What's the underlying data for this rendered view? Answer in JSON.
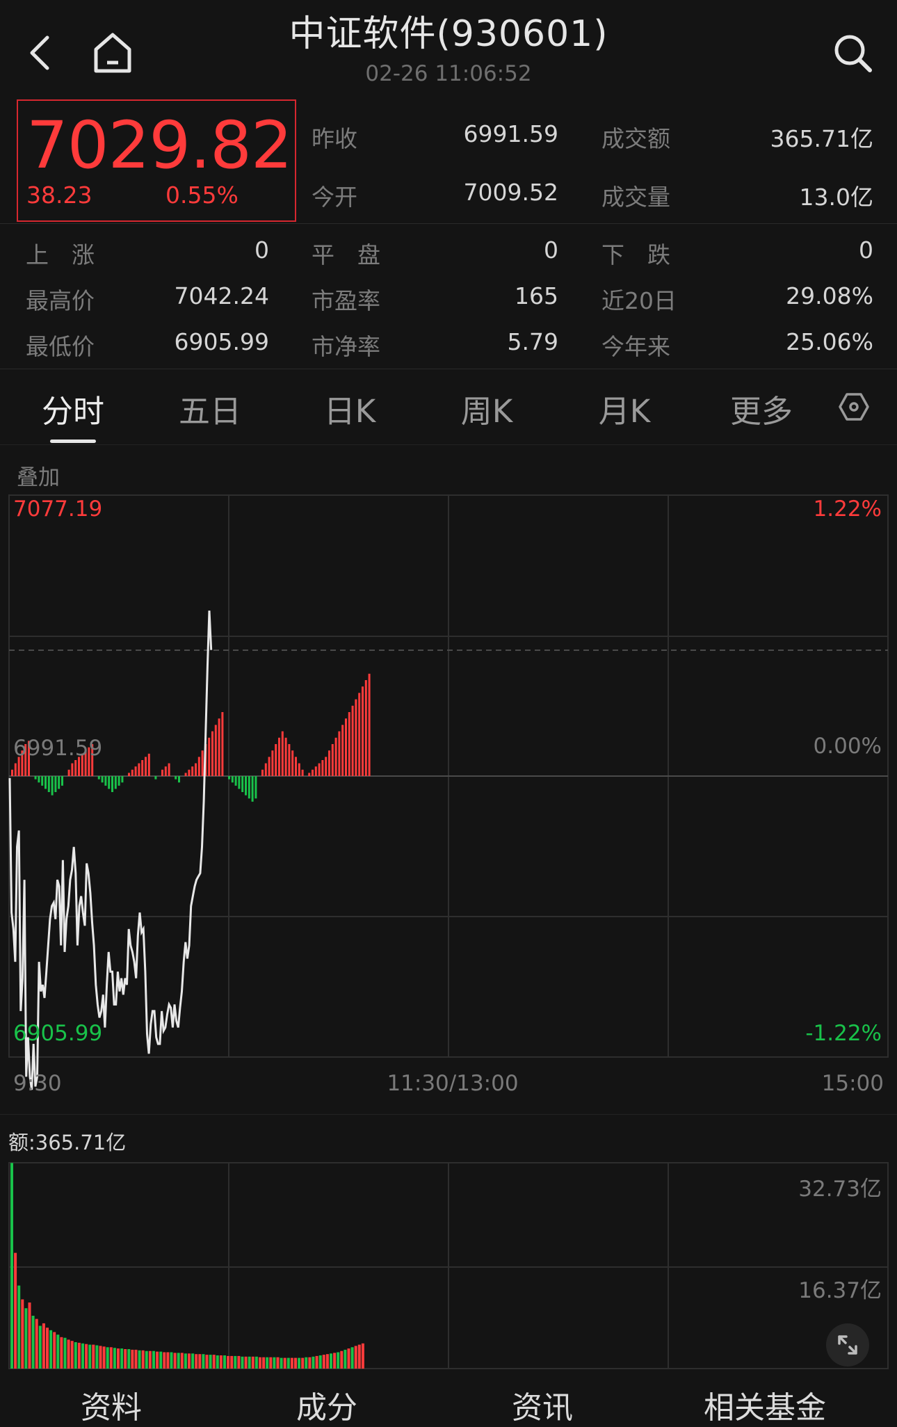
{
  "header": {
    "title": "中证软件(930601)",
    "datetime": "02-26 11:06:52",
    "back_icon": "chevron-left-icon",
    "home_icon": "home-icon",
    "search_icon": "search-icon"
  },
  "quote": {
    "price": "7029.82",
    "change": "38.23",
    "change_pct": "0.55%",
    "stats_top": [
      {
        "label": "昨收",
        "value": "6991.59"
      },
      {
        "label": "成交额",
        "value": "365.71亿"
      },
      {
        "label": "今开",
        "value": "7009.52"
      },
      {
        "label": "成交量",
        "value": "13.0亿"
      }
    ],
    "stats": [
      {
        "label": "上　涨",
        "value": "0"
      },
      {
        "label": "平　盘",
        "value": "0"
      },
      {
        "label": "下　跌",
        "value": "0"
      },
      {
        "label": "最高价",
        "value": "7042.24"
      },
      {
        "label": "市盈率",
        "value": "165"
      },
      {
        "label": "近20日",
        "value": "29.08%"
      },
      {
        "label": "最低价",
        "value": "6905.99"
      },
      {
        "label": "市净率",
        "value": "5.79"
      },
      {
        "label": "今年来",
        "value": "25.06%"
      }
    ]
  },
  "tabs": [
    {
      "label": "分时",
      "active": true
    },
    {
      "label": "五日"
    },
    {
      "label": "日K"
    },
    {
      "label": "周K"
    },
    {
      "label": "月K"
    },
    {
      "label": "更多"
    }
  ],
  "settings_icon": "hexagon-settings-icon",
  "overlay_label": "叠加",
  "colors": {
    "up": "#ff3b3b",
    "down": "#19c24a",
    "line": "#e8e8e8",
    "background": "#141414"
  },
  "chart_data": {
    "type": "line",
    "price_axis": {
      "max_label": "7077.19",
      "ref_label": "6991.59",
      "min_label": "6905.99",
      "ylim": [
        6905.99,
        7077.19
      ]
    },
    "pct_axis": {
      "max_label": "1.22%",
      "ref_label": "0.00%",
      "min_label": "-1.22%"
    },
    "x_labels": [
      "9:30",
      "11:30/13:00",
      "15:00"
    ],
    "series": [
      {
        "values": [
          6991,
          6950,
          6945,
          6935,
          6970,
          6975,
          6920,
          6930,
          6960,
          6900,
          6912,
          6900,
          6896,
          6910,
          6897,
          6900,
          6935,
          6926,
          6928,
          6924,
          6932,
          6940,
          6948,
          6952,
          6953,
          6948,
          6960,
          6958,
          6940,
          6966,
          6938,
          6948,
          6952,
          6960,
          6963,
          6970,
          6962,
          6940,
          6952,
          6955,
          6950,
          6946,
          6965,
          6962,
          6956,
          6947,
          6940,
          6928,
          6922,
          6918,
          6920,
          6925,
          6915,
          6928,
          6938,
          6932,
          6932,
          6922,
          6922,
          6932,
          6926,
          6930,
          6925,
          6930,
          6928,
          6945,
          6940,
          6938,
          6935,
          6930,
          6943,
          6950,
          6944,
          6945,
          6932,
          6913,
          6907,
          6916,
          6920,
          6920,
          6912,
          6910,
          6910,
          6920,
          6914,
          6915,
          6919,
          6922,
          6921,
          6915,
          6922,
          6917,
          6915,
          6921,
          6926,
          6935,
          6941,
          6936,
          6940,
          6952,
          6955,
          6958,
          6960,
          6961,
          6962,
          6970,
          6984,
          7005,
          7025,
          7042,
          7030
        ]
      }
    ],
    "direction_bars": [
      2,
      4,
      6,
      8,
      10,
      11,
      0,
      -1,
      -2,
      -3,
      -4,
      -5,
      -6,
      -5,
      -4,
      -3,
      0,
      2,
      4,
      5,
      6,
      7,
      8,
      9,
      10,
      0,
      -1,
      -2,
      -3,
      -4,
      -5,
      -4,
      -3,
      -2,
      0,
      1,
      2,
      3,
      4,
      5,
      6,
      7,
      0,
      -1,
      0,
      2,
      3,
      4,
      0,
      -1,
      -2,
      0,
      1,
      2,
      3,
      4,
      6,
      8,
      10,
      12,
      14,
      16,
      18,
      20,
      0,
      -1,
      -2,
      -3,
      -4,
      -5,
      -6,
      -7,
      -8,
      -7,
      0,
      2,
      4,
      6,
      8,
      10,
      12,
      14,
      12,
      10,
      8,
      6,
      4,
      2,
      0,
      1,
      2,
      3,
      4,
      5,
      6,
      8,
      10,
      12,
      14,
      16,
      18,
      20,
      22,
      24,
      26,
      28,
      30,
      32
    ],
    "turnover": {
      "label": "额:365.71亿",
      "max_label": "32.73亿",
      "mid_label": "16.37亿",
      "ylim": [
        0,
        32.73
      ],
      "values": [
        32.7,
        18.4,
        13.2,
        11.0,
        9.6,
        10.5,
        8.4,
        7.9,
        6.8,
        7.2,
        6.5,
        6.1,
        5.8,
        5.4,
        5.0,
        4.9,
        4.6,
        4.4,
        4.2,
        4.1,
        4.0,
        3.9,
        3.8,
        3.8,
        3.7,
        3.6,
        3.5,
        3.4,
        3.4,
        3.3,
        3.2,
        3.2,
        3.1,
        3.1,
        3.0,
        3.0,
        2.9,
        2.9,
        2.8,
        2.8,
        2.8,
        2.7,
        2.7,
        2.6,
        2.6,
        2.6,
        2.5,
        2.5,
        2.5,
        2.4,
        2.4,
        2.4,
        2.3,
        2.3,
        2.3,
        2.2,
        2.2,
        2.2,
        2.1,
        2.1,
        2.1,
        2.0,
        2.0,
        2.0,
        2.0,
        1.9,
        1.9,
        1.9,
        1.9,
        1.9,
        1.8,
        1.8,
        1.8,
        1.8,
        1.8,
        1.8,
        1.7,
        1.7,
        1.7,
        1.7,
        1.7,
        1.7,
        1.7,
        1.8,
        1.8,
        1.9,
        2.0,
        2.1,
        2.2,
        2.3,
        2.4,
        2.5,
        2.6,
        2.8,
        3.0,
        3.2,
        3.4,
        3.6,
        3.8,
        4.0
      ],
      "up_flags": [
        0,
        1,
        0,
        1,
        0,
        1,
        0,
        1,
        0,
        1,
        1,
        0,
        1,
        0,
        1,
        0,
        1,
        1,
        0,
        1,
        0,
        1,
        0,
        1,
        0,
        1,
        1,
        0,
        1,
        0,
        1,
        0,
        1,
        0,
        1,
        1,
        0,
        1,
        0,
        1,
        0,
        1,
        0,
        1,
        1,
        0,
        1,
        0,
        1,
        0,
        1,
        0,
        1,
        1,
        0,
        1,
        0,
        1,
        0,
        1,
        0,
        1,
        1,
        0,
        1,
        0,
        1,
        0,
        1,
        0,
        1,
        1,
        0,
        1,
        0,
        1,
        0,
        1,
        0,
        1,
        1,
        0,
        1,
        0,
        1,
        0,
        1,
        0,
        1,
        1,
        0,
        1,
        0,
        1,
        0,
        1,
        0,
        1,
        1,
        1
      ]
    }
  },
  "zoom_icon": "expand-diagonal-icon",
  "bottom_tabs": [
    "资料",
    "成分",
    "资讯",
    "相关基金"
  ]
}
